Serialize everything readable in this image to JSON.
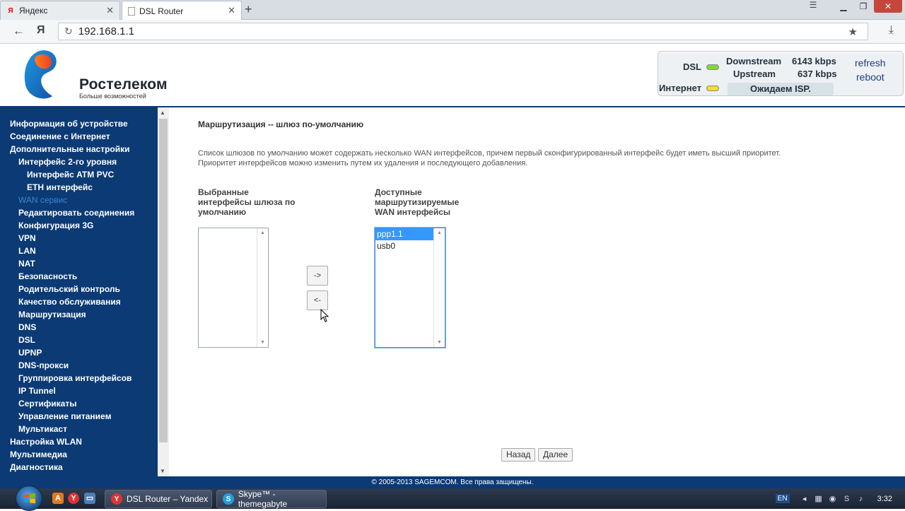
{
  "browser": {
    "tabs": [
      {
        "label": "Яндекс",
        "favicon": "yandex-icon"
      },
      {
        "label": "DSL Router",
        "favicon": "page-icon"
      }
    ],
    "new_tab": "+",
    "url": "192.168.1.1",
    "yandex_button": "Я"
  },
  "header": {
    "brand": "Ростелеком",
    "slogan": "Больше возможностей",
    "status": {
      "dsl_label": "DSL",
      "internet_label": "Интернет",
      "downstream_label": "Downstream",
      "downstream_value": "6143 kbps",
      "upstream_label": "Upstream",
      "upstream_value": "637 kbps",
      "isp_status": "Ожидаем ISP.",
      "refresh": "refresh",
      "reboot": "reboot",
      "dsl_led": "#7fdc2a",
      "internet_led": "#f2e02a"
    }
  },
  "sidebar": {
    "items": [
      {
        "label": "Информация об устройстве",
        "level": 0
      },
      {
        "label": "Соединение с Интернет",
        "level": 0
      },
      {
        "label": "Дополнительные настройки",
        "level": 0
      },
      {
        "label": "Интерфейс 2-го уровня",
        "level": 1
      },
      {
        "label": "Интерфейс ATM PVC",
        "level": 2
      },
      {
        "label": "ETH интерфейс",
        "level": 2
      },
      {
        "label": "WAN сервис",
        "level": 1
      },
      {
        "label": "Редактировать соединения",
        "level": 1
      },
      {
        "label": "Конфигурация 3G",
        "level": 1
      },
      {
        "label": "VPN",
        "level": 1
      },
      {
        "label": "LAN",
        "level": 1
      },
      {
        "label": "NAT",
        "level": 1
      },
      {
        "label": "Безопасность",
        "level": 1
      },
      {
        "label": "Родительский контроль",
        "level": 1
      },
      {
        "label": "Качество обслуживания",
        "level": 1
      },
      {
        "label": "Маршрутизация",
        "level": 1
      },
      {
        "label": "DNS",
        "level": 1
      },
      {
        "label": "DSL",
        "level": 1
      },
      {
        "label": "UPNP",
        "level": 1
      },
      {
        "label": "DNS-прокси",
        "level": 1
      },
      {
        "label": "Группировка интерфейсов",
        "level": 1
      },
      {
        "label": "IP Tunnel",
        "level": 1
      },
      {
        "label": "Сертификаты",
        "level": 1
      },
      {
        "label": "Управление питанием",
        "level": 1
      },
      {
        "label": "Мультикаст",
        "level": 1
      },
      {
        "label": "Настройка WLAN",
        "level": 0
      },
      {
        "label": "Мультимедиа",
        "level": 0
      },
      {
        "label": "Диагностика",
        "level": 0
      }
    ],
    "active_index": 6
  },
  "main": {
    "title": "Маршрутизация -- шлюз по-умолчанию",
    "description_line1": "Список шлюзов по умолчанию может содержать несколько WAN интерфейсов, причем первый сконфигурированный интерфейс будет иметь высший приоритет.",
    "description_line2": "Приоритет интерфейсов можно изменить путем их удаления и последующего добавления.",
    "selected_label_1": "Выбранные",
    "selected_label_2": "интерфейсы шлюза по",
    "selected_label_3": "умолчанию",
    "available_label_1": "Доступные",
    "available_label_2": "маршрутизируемые",
    "available_label_3": "WAN интерфейсы",
    "selected_items": [],
    "available_items": [
      {
        "label": "ppp1.1",
        "selected": true
      },
      {
        "label": "usb0",
        "selected": false
      }
    ],
    "move_right": "->",
    "move_left": "<-",
    "back": "Назад",
    "next": "Далее"
  },
  "footer": {
    "copyright": "© 2005-2013 SAGEMCOM. Все права защищены."
  },
  "taskbar": {
    "tasks": [
      {
        "label": "DSL Router – Yandex"
      },
      {
        "label": "Skype™ - themegabyte"
      }
    ],
    "lang": "EN",
    "time": "3:32"
  }
}
